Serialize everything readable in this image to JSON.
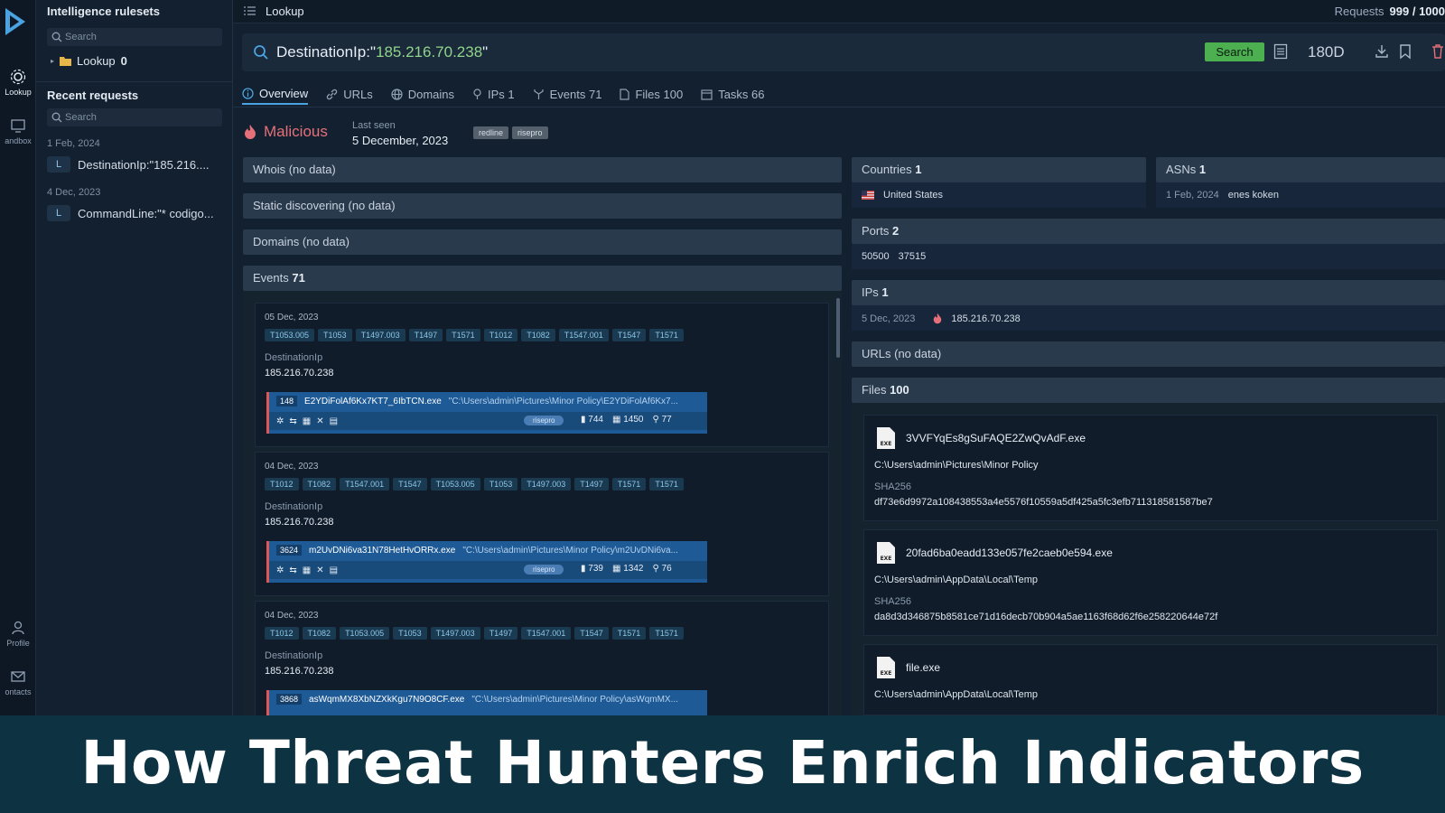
{
  "rail": {
    "items": [
      {
        "label": "Lookup"
      },
      {
        "label": "andbox"
      },
      {
        "label": "Profile"
      },
      {
        "label": "ontacts"
      }
    ]
  },
  "sidebar": {
    "rulesets_title": "Intelligence rulesets",
    "search_placeholder": "Search",
    "tree_item": {
      "label": "Lookup",
      "count": "0"
    },
    "recent_title": "Recent requests",
    "recent_search_placeholder": "Search",
    "groups": [
      {
        "date": "1 Feb, 2024",
        "items": [
          {
            "badge": "L",
            "text": "DestinationIp:\"185.216...."
          }
        ]
      },
      {
        "date": "4 Dec, 2023",
        "items": [
          {
            "badge": "L",
            "text": "CommandLine:\"* codigo..."
          }
        ]
      }
    ]
  },
  "topbar": {
    "title": "Lookup",
    "requests_label": "Requests",
    "requests_value": "999 / 1000"
  },
  "query": {
    "key": "DestinationIp:\"",
    "value": "185.216.70.238",
    "close": "\"",
    "search_button": "Search",
    "range": "180D"
  },
  "tabs": [
    {
      "label": "Overview",
      "icon": "info-icon"
    },
    {
      "label": "URLs",
      "icon": "link-icon"
    },
    {
      "label": "Domains",
      "icon": "globe-icon"
    },
    {
      "label": "IPs 1",
      "icon": "pin-icon"
    },
    {
      "label": "Events 71",
      "icon": "branch-icon"
    },
    {
      "label": "Files 100",
      "icon": "file-icon"
    },
    {
      "label": "Tasks 66",
      "icon": "calendar-icon"
    }
  ],
  "verdict": {
    "label": "Malicious",
    "last_seen_label": "Last seen",
    "last_seen_value": "5 December, 2023",
    "tags": [
      "redline",
      "risepro"
    ]
  },
  "left_panels": {
    "whois": "Whois (no data)",
    "static": "Static discovering (no data)",
    "domains": "Domains (no data)",
    "events_label": "Events",
    "events_count": "71"
  },
  "events": [
    {
      "date": "05 Dec, 2023",
      "tags": [
        "T1053.005",
        "T1053",
        "T1497.003",
        "T1497",
        "T1571",
        "T1012",
        "T1082",
        "T1547.001",
        "T1547",
        "T1571"
      ],
      "field": "DestinationIp",
      "value": "185.216.70.238",
      "pid": "148",
      "exe": "E2YDiFolAf6Kx7KT7_6IbTCN.exe",
      "path": "\"C:\\Users\\admin\\Pictures\\Minor Policy\\E2YDiFolAf6Kx7...",
      "tag": "risepro",
      "s1": "744",
      "s2": "1450",
      "s3": "77"
    },
    {
      "date": "04 Dec, 2023",
      "tags": [
        "T1012",
        "T1082",
        "T1547.001",
        "T1547",
        "T1053.005",
        "T1053",
        "T1497.003",
        "T1497",
        "T1571",
        "T1571"
      ],
      "field": "DestinationIp",
      "value": "185.216.70.238",
      "pid": "3624",
      "exe": "m2UvDNi6va31N78HetHvORRx.exe",
      "path": "\"C:\\Users\\admin\\Pictures\\Minor Policy\\m2UvDNi6va...",
      "tag": "risepro",
      "s1": "739",
      "s2": "1342",
      "s3": "76"
    },
    {
      "date": "04 Dec, 2023",
      "tags": [
        "T1012",
        "T1082",
        "T1053.005",
        "T1053",
        "T1497.003",
        "T1497",
        "T1547.001",
        "T1547",
        "T1571",
        "T1571"
      ],
      "field": "DestinationIp",
      "value": "185.216.70.238",
      "pid": "3868",
      "exe": "asWqmMX8XbNZXkKgu7N9O8CF.exe",
      "path": "\"C:\\Users\\admin\\Pictures\\Minor Policy\\asWqmMX...",
      "tag": "",
      "s1": "",
      "s2": "",
      "s3": ""
    }
  ],
  "right_panels": {
    "countries_label": "Countries",
    "countries_count": "1",
    "country": "United States",
    "asns_label": "ASNs",
    "asns_count": "1",
    "asn_date": "1 Feb, 2024",
    "asn_name": "enes koken",
    "ports_label": "Ports",
    "ports_count": "2",
    "ports": [
      "50500",
      "37515"
    ],
    "ips_label": "IPs",
    "ips_count": "1",
    "ip_date": "5 Dec, 2023",
    "ip_value": "185.216.70.238",
    "urls": "URLs (no data)",
    "files_label": "Files",
    "files_count": "100"
  },
  "files": [
    {
      "name": "3VVFYqEs8gSuFAQE2ZwQvAdF.exe",
      "path": "C:\\Users\\admin\\Pictures\\Minor Policy",
      "sha_label": "SHA256",
      "sha": "df73e6d9972a108438553a4e5576f10559a5df425a5fc3efb711318581587be7"
    },
    {
      "name": "20fad6ba0eadd133e057fe2caeb0e594.exe",
      "path": "C:\\Users\\admin\\AppData\\Local\\Temp",
      "sha_label": "SHA256",
      "sha": "da8d3d346875b8581ce71d16decb70b904a5ae1163f68d62f6e258220644e72f"
    },
    {
      "name": "file.exe",
      "path": "C:\\Users\\admin\\AppData\\Local\\Temp",
      "sha_label": "",
      "sha": ""
    }
  ],
  "caption": "How Threat Hunters Enrich Indicators",
  "colors": {
    "accent": "#4aa3e0",
    "malicious": "#e5707a",
    "search": "#4caf50",
    "query_value": "#8fd48a"
  }
}
